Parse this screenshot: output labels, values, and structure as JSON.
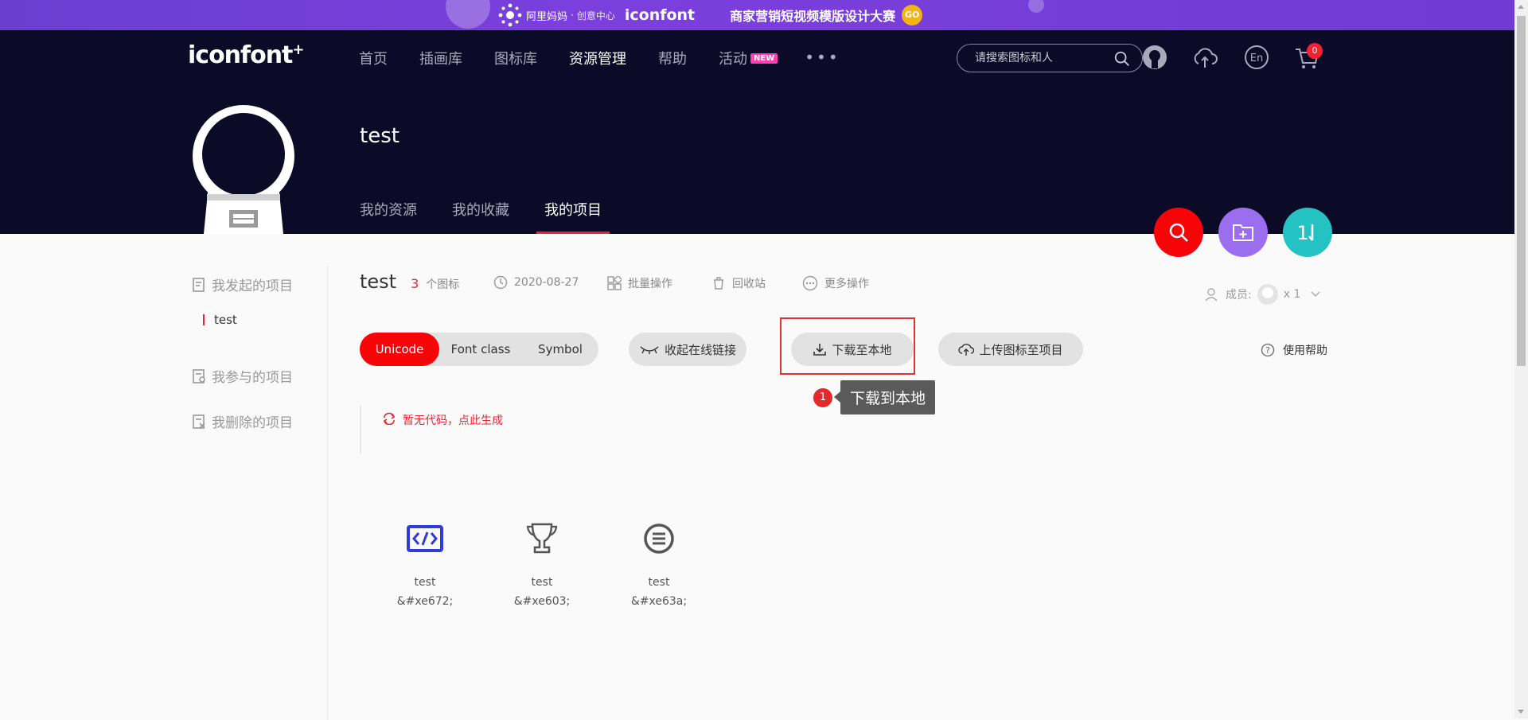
{
  "banner": {
    "partner": "阿里妈妈",
    "partner_sub": "创意中心",
    "brand": "iconfont",
    "promo": "商家营销短视频模版设计大赛",
    "go": "GO"
  },
  "header": {
    "logo": "iconfont",
    "nav": [
      "首页",
      "插画库",
      "图标库",
      "资源管理",
      "帮助",
      "活动"
    ],
    "nav_active": "资源管理",
    "new_badge": "NEW",
    "more": "•••",
    "search_placeholder": "请搜索图标和人",
    "cart_count": "0"
  },
  "profile": {
    "title": "test",
    "tabs": [
      "我的资源",
      "我的收藏",
      "我的项目"
    ],
    "active_tab": "我的项目"
  },
  "sidebar": {
    "my_projects": "我发起的项目",
    "current_project": "test",
    "joined": "我参与的项目",
    "deleted": "我删除的项目"
  },
  "project": {
    "name": "test",
    "icon_count": "3",
    "icon_unit": "个图标",
    "date": "2020-08-27",
    "batch": "批量操作",
    "recycle": "回收站",
    "more_ops": "更多操作",
    "members_label": "成员:",
    "members_count": "x 1"
  },
  "toolbar": {
    "modes": [
      "Unicode",
      "Font class",
      "Symbol"
    ],
    "active_mode": "Unicode",
    "collapse_link": "收起在线链接",
    "download": "下载至本地",
    "upload": "上传图标至项目",
    "help": "使用帮助"
  },
  "tooltip": {
    "step": "1",
    "text": "下载到本地"
  },
  "code_area": {
    "message": "暂无代码，点此生成"
  },
  "icons": [
    {
      "name": "test",
      "code": "&#xe672;",
      "icon": "code-icon",
      "color": "#2f3cd6"
    },
    {
      "name": "test",
      "code": "&#xe603;",
      "icon": "trophy-icon",
      "color": "#555555"
    },
    {
      "name": "test",
      "code": "&#xe63a;",
      "icon": "list-circle-icon",
      "color": "#555555"
    }
  ],
  "colors": {
    "accent_red": "#e82632",
    "header_bg": "#0c0b27",
    "fab_search": "#f80308",
    "fab_folder": "#9b6ef0",
    "fab_sort": "#25c2c4"
  }
}
